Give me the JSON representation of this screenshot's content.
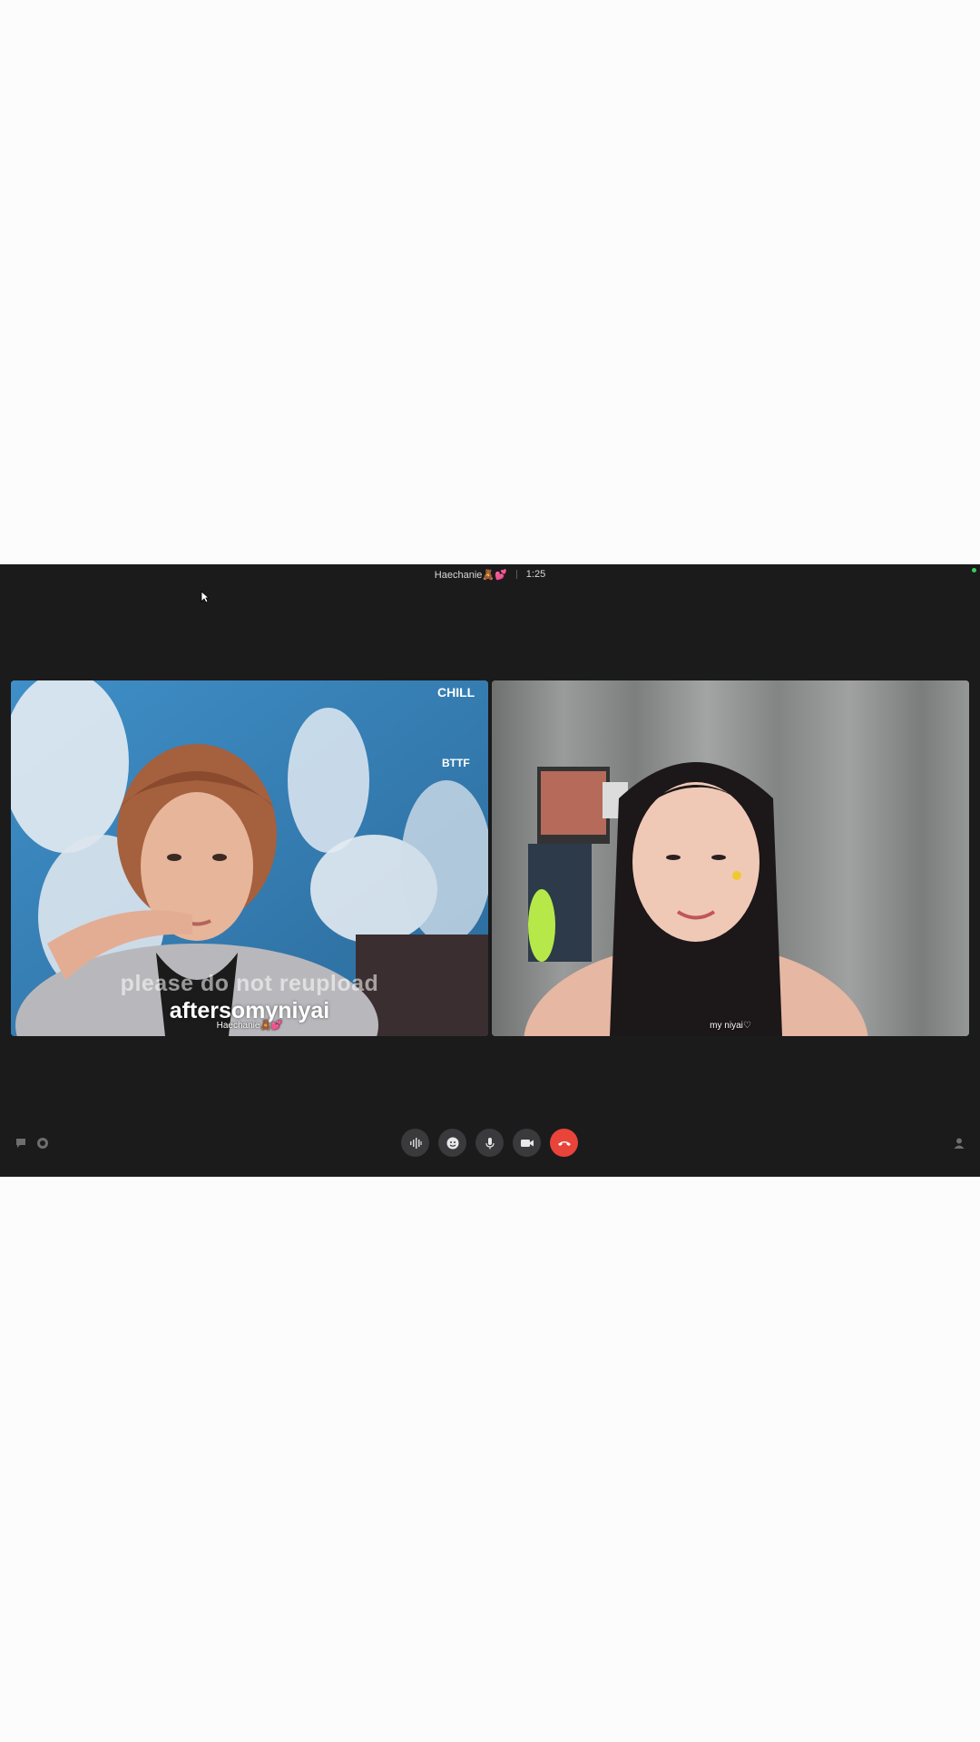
{
  "call": {
    "contact_name": "Haechanie🧸💕",
    "duration": "1:25"
  },
  "participants": [
    {
      "name": "Haechanie🧸💕",
      "overlay_text": "please do not reupload",
      "overlay_handle": "aftersomyniyai"
    },
    {
      "name": "my niyai♡"
    }
  ],
  "controls": [
    {
      "icon": "audio-waveform-icon"
    },
    {
      "icon": "effects-icon"
    },
    {
      "icon": "microphone-icon"
    },
    {
      "icon": "camera-icon"
    },
    {
      "icon": "end-call-icon",
      "color": "#e8443a"
    }
  ],
  "colors": {
    "background": "#1b1b1c",
    "end_call": "#e8443a",
    "online": "#2fd15a"
  }
}
